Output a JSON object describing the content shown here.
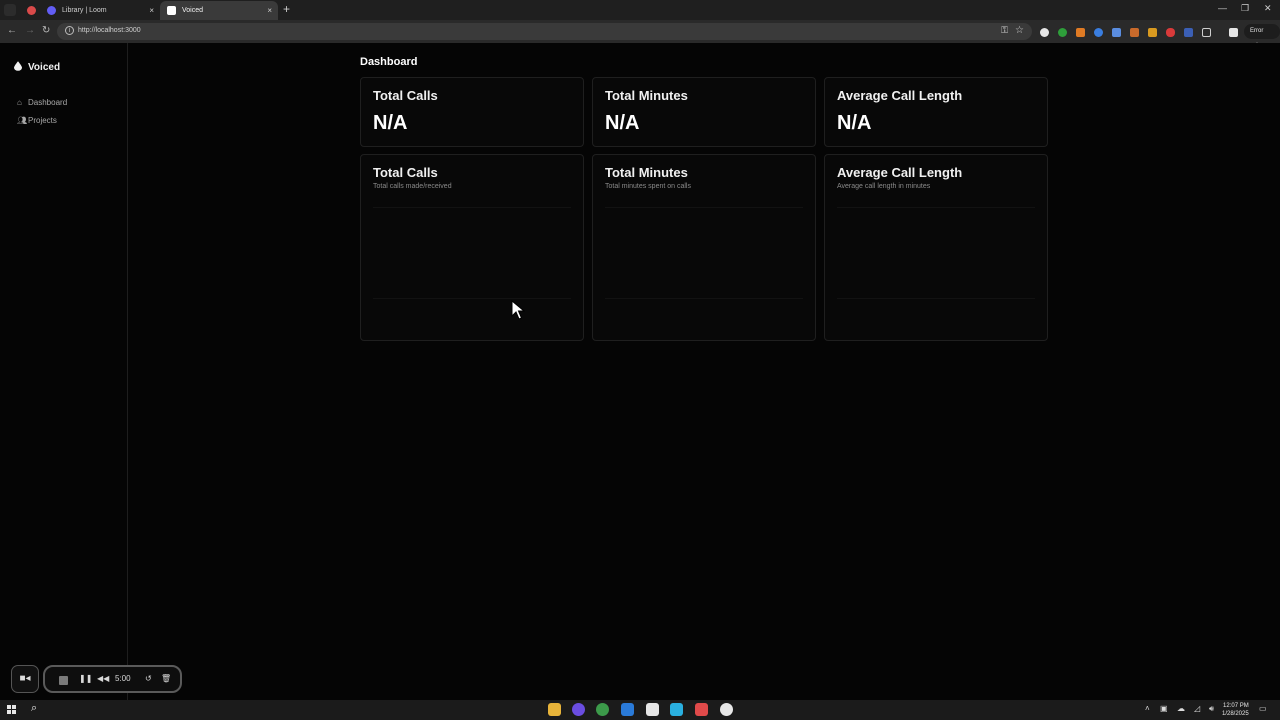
{
  "browser": {
    "tabs": [
      {
        "label": "Library | Loom",
        "active": false
      },
      {
        "label": "Voiced",
        "active": true
      }
    ],
    "url": "http://localhost:3000",
    "error_label": "Error",
    "new_tab": "+",
    "close_glyph": "×",
    "window_controls": [
      "—",
      "❐",
      "✕"
    ],
    "nav_buttons": [
      "←",
      "→",
      "↻"
    ]
  },
  "sidebar": {
    "brand": "Voiced",
    "items": [
      {
        "label": "Dashboard",
        "icon": "home-icon"
      },
      {
        "label": "Projects",
        "icon": "users-icon"
      }
    ]
  },
  "main": {
    "title": "Dashboard",
    "stats": [
      {
        "title": "Total Calls",
        "value": "N/A"
      },
      {
        "title": "Total Minutes",
        "value": "N/A"
      },
      {
        "title": "Average Call Length",
        "value": "N/A"
      }
    ],
    "charts": [
      {
        "title": "Total Calls",
        "subtitle": "Total calls made/received"
      },
      {
        "title": "Total Minutes",
        "subtitle": "Total minutes spent on calls"
      },
      {
        "title": "Average Call Length",
        "subtitle": "Average call length in minutes"
      }
    ]
  },
  "recorder": {
    "time": "5:00"
  },
  "taskbar": {
    "time": "12:07 PM",
    "date": "1/28/2025"
  },
  "colors": {
    "background": "#050505",
    "card_border": "#1f1f1f",
    "text_primary": "#ffffff",
    "text_muted": "#8a8a8a"
  }
}
